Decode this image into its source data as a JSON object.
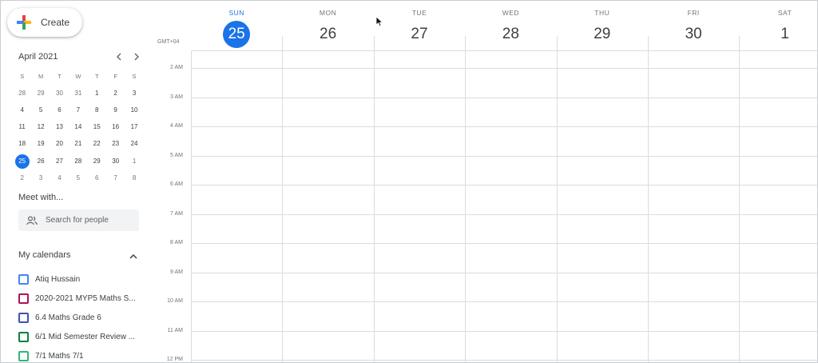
{
  "create": {
    "label": "Create"
  },
  "mini_calendar": {
    "title": "April 2021",
    "dow": [
      "S",
      "M",
      "T",
      "W",
      "T",
      "F",
      "S"
    ],
    "weeks": [
      [
        {
          "d": "28",
          "o": true
        },
        {
          "d": "29",
          "o": true
        },
        {
          "d": "30",
          "o": true
        },
        {
          "d": "31",
          "o": true
        },
        {
          "d": "1"
        },
        {
          "d": "2"
        },
        {
          "d": "3"
        }
      ],
      [
        {
          "d": "4"
        },
        {
          "d": "5"
        },
        {
          "d": "6"
        },
        {
          "d": "7"
        },
        {
          "d": "8"
        },
        {
          "d": "9"
        },
        {
          "d": "10"
        }
      ],
      [
        {
          "d": "11"
        },
        {
          "d": "12"
        },
        {
          "d": "13"
        },
        {
          "d": "14"
        },
        {
          "d": "15"
        },
        {
          "d": "16"
        },
        {
          "d": "17"
        }
      ],
      [
        {
          "d": "18"
        },
        {
          "d": "19"
        },
        {
          "d": "20"
        },
        {
          "d": "21"
        },
        {
          "d": "22"
        },
        {
          "d": "23"
        },
        {
          "d": "24"
        }
      ],
      [
        {
          "d": "25",
          "today": true
        },
        {
          "d": "26"
        },
        {
          "d": "27"
        },
        {
          "d": "28"
        },
        {
          "d": "29"
        },
        {
          "d": "30"
        },
        {
          "d": "1",
          "o": true
        }
      ],
      [
        {
          "d": "2",
          "o": true
        },
        {
          "d": "3",
          "o": true
        },
        {
          "d": "4",
          "o": true
        },
        {
          "d": "5",
          "o": true
        },
        {
          "d": "6",
          "o": true
        },
        {
          "d": "7",
          "o": true
        },
        {
          "d": "8",
          "o": true
        }
      ]
    ]
  },
  "meet": {
    "title": "Meet with...",
    "search_placeholder": "Search for people"
  },
  "my_calendars": {
    "title": "My calendars",
    "items": [
      {
        "label": "Atiq Hussain",
        "color": "#4285f4"
      },
      {
        "label": "2020-2021 MYP5 Maths S...",
        "color": "#ad1457"
      },
      {
        "label": "6.4 Maths Grade 6",
        "color": "#3f51b5"
      },
      {
        "label": "6/1 Mid Semester Review ...",
        "color": "#0b8043"
      },
      {
        "label": "7/1 Maths 7/1",
        "color": "#33b679"
      }
    ]
  },
  "week": {
    "timezone": "GMT+04",
    "days": [
      {
        "dow": "SUN",
        "num": "25",
        "current": true
      },
      {
        "dow": "MON",
        "num": "26"
      },
      {
        "dow": "TUE",
        "num": "27"
      },
      {
        "dow": "WED",
        "num": "28"
      },
      {
        "dow": "THU",
        "num": "29"
      },
      {
        "dow": "FRI",
        "num": "30"
      },
      {
        "dow": "SAT",
        "num": "1"
      }
    ],
    "hours": [
      "2 AM",
      "3 AM",
      "4 AM",
      "5 AM",
      "6 AM",
      "7 AM",
      "8 AM",
      "9 AM",
      "10 AM",
      "11 AM",
      "12 PM"
    ]
  },
  "colors": {
    "accent": "#1a73e8",
    "grid": "#dadce0"
  }
}
